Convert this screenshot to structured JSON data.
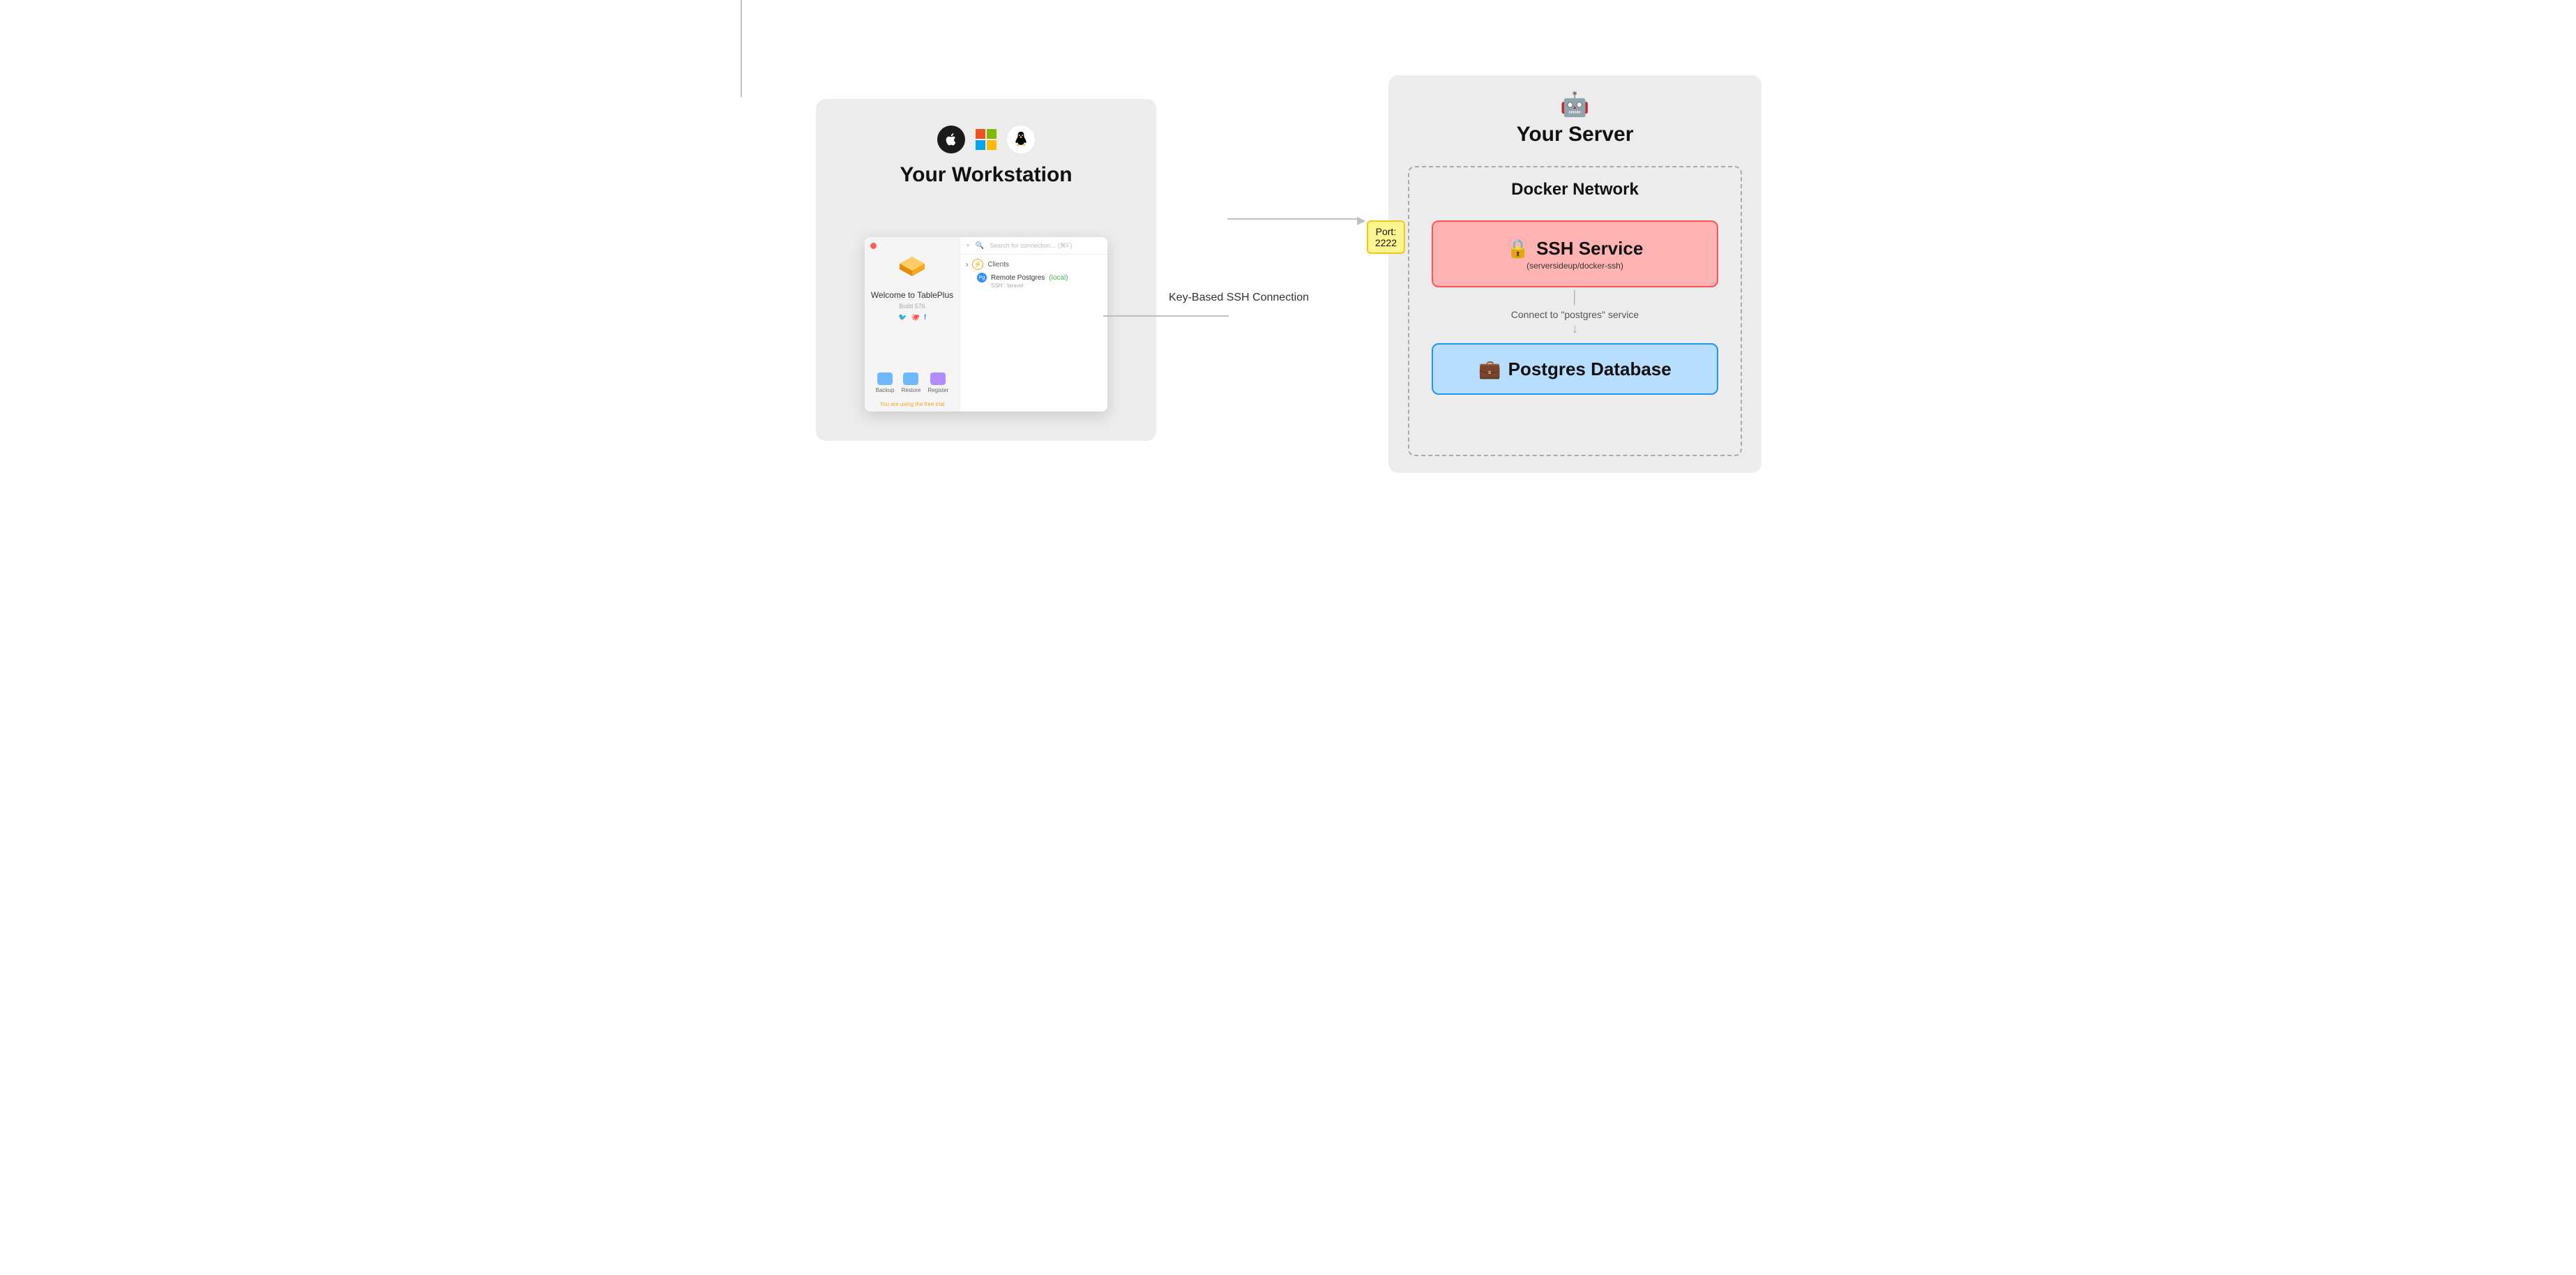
{
  "workstation": {
    "title": "Your Workstation",
    "icons": {
      "apple": "apple-icon",
      "microsoft": "microsoft-icon",
      "linux": "linux-icon"
    }
  },
  "server": {
    "emoji": "🤖",
    "title": "Your Server",
    "docker_title": "Docker Network",
    "port_label": "Port:",
    "port_value": "2222",
    "ssh": {
      "emoji": "🔒",
      "title": "SSH Service",
      "subtitle": "(serversideup/docker-ssh)"
    },
    "connect_label": "Connect to \"postgres\" service",
    "postgres": {
      "emoji": "💼",
      "title": "Postgres Database"
    }
  },
  "connection": {
    "label": "Key-Based SSH Connection"
  },
  "app": {
    "welcome": "Welcome to TablePlus",
    "build": "Build 576",
    "actions": {
      "backup": "Backup",
      "restore": "Restore",
      "register": "Register"
    },
    "trial": "You are using the free trial",
    "plus_glyph": "+",
    "search_glyph": "🔍",
    "search_placeholder": "Search for connection... (⌘F)",
    "chevron_glyph": "›",
    "group_label": "Clients",
    "item": {
      "badge": "Pg",
      "name": "Remote Postgres",
      "local_tag": "(local)",
      "subtitle": "SSH : laravel"
    },
    "social": {
      "twitter": "🐦",
      "github": "🐙",
      "facebook": "f"
    }
  }
}
